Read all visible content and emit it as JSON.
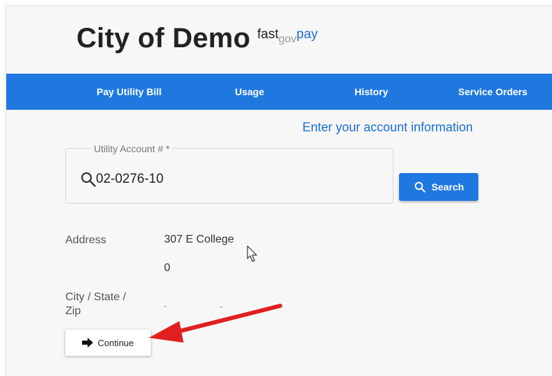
{
  "brand": {
    "title": "City of Demo",
    "suffix_fast": "fast",
    "suffix_gov": "gov",
    "suffix_pay": "pay"
  },
  "nav": {
    "items": [
      {
        "label": "Pay Utility Bill"
      },
      {
        "label": "Usage"
      },
      {
        "label": "History"
      },
      {
        "label": "Service Orders"
      }
    ]
  },
  "form": {
    "heading": "Enter your account information",
    "account_label": "Utility Account # *",
    "account_value": "02-0276-10",
    "search_label": "Search"
  },
  "details": {
    "address_label": "Address",
    "address_line1": "307 E College",
    "address_line2": "0",
    "city_label_line1": "City / State /",
    "city_label_line2": "Zip"
  },
  "actions": {
    "continue_label": "Continue"
  },
  "icons": {
    "search": "search-icon",
    "arrow": "arrow-right-icon",
    "cursor": "mouse-cursor-icon",
    "annotation": "red-annotation-arrow"
  },
  "colors": {
    "accent": "#1f78e0",
    "brand_pay": "#1a6fd6",
    "annotation": "#e02020"
  }
}
